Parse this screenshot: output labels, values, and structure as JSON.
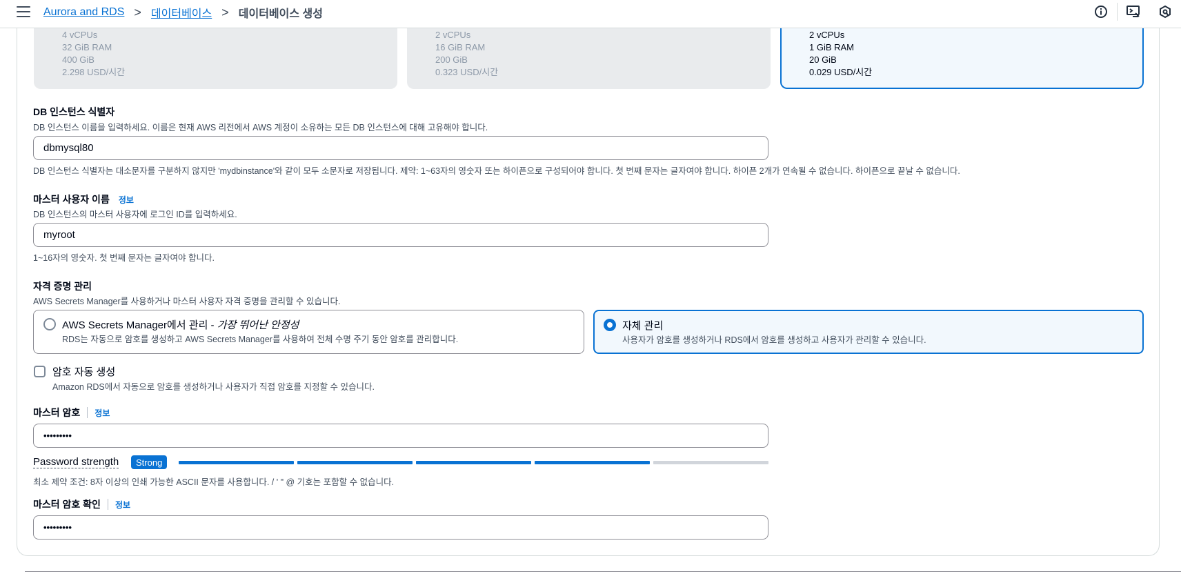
{
  "breadcrumb": {
    "items": [
      "Aurora and RDS",
      "데이터베이스"
    ],
    "current": "데이터베이스 생성",
    "separator": ">"
  },
  "top_icons": [
    "info-icon",
    "cloudshell-icon",
    "settings-hex-icon"
  ],
  "instance_cards": [
    {
      "state": "disabled",
      "lines": [
        "4 vCPUs",
        "32 GiB RAM",
        "400 GiB",
        "2.298 USD/시간"
      ]
    },
    {
      "state": "disabled",
      "lines": [
        "2 vCPUs",
        "16 GiB RAM",
        "200 GiB",
        "0.323 USD/시간"
      ]
    },
    {
      "state": "selected",
      "lines": [
        "2 vCPUs",
        "1 GiB RAM",
        "20 GiB",
        "0.029 USD/시간"
      ]
    }
  ],
  "db_identifier": {
    "label": "DB 인스턴스 식별자",
    "description": "DB 인스턴스 이름을 입력하세요. 이름은 현재 AWS 리전에서 AWS 계정이 소유하는 모든 DB 인스턴스에 대해 고유해야 합니다.",
    "value": "dbmysql80",
    "constraint": "DB 인스턴스 식별자는 대소문자를 구분하지 않지만 'mydbinstance'와 같이 모두 소문자로 저장됩니다. 제약: 1~63자의 영숫자 또는 하이픈으로 구성되어야 합니다. 첫 번째 문자는 글자여야 합니다. 하이픈 2개가 연속될 수 없습니다. 하이픈으로 끝날 수 없습니다."
  },
  "master_username": {
    "label": "마스터 사용자 이름",
    "info": "정보",
    "description": "DB 인스턴스의 마스터 사용자에 로그인 ID를 입력하세요.",
    "value": "myroot",
    "constraint": "1~16자의 영숫자. 첫 번째 문자는 글자여야 합니다."
  },
  "credentials": {
    "label": "자격 증명 관리",
    "description": "AWS Secrets Manager를 사용하거나 마스터 사용자 자격 증명을 관리할 수 있습니다.",
    "options": [
      {
        "title": "AWS Secrets Manager에서 관리 - ",
        "title_italic": "가장 뛰어난 안정성",
        "desc": "RDS는 자동으로 암호를 생성하고 AWS Secrets Manager를 사용하여 전체 수명 주기 동안 암호를 관리합니다.",
        "selected": false
      },
      {
        "title": "자체 관리",
        "desc": "사용자가 암호를 생성하거나 RDS에서 암호를 생성하고 사용자가 관리할 수 있습니다.",
        "selected": true
      }
    ]
  },
  "auto_password": {
    "label": "암호 자동 생성",
    "description": "Amazon RDS에서 자동으로 암호를 생성하거나 사용자가 직접 암호를 지정할 수 있습니다.",
    "checked": false
  },
  "master_password": {
    "label": "마스터 암호",
    "info": "정보",
    "value": "•••••••••",
    "strength_label": "Password strength",
    "strength_value": "Strong",
    "strength_level": 0.8,
    "constraint": "최소 제약 조건: 8자 이상의 인쇄 가능한 ASCII 문자를 사용합니다. / ' \" @ 기호는 포함할 수 없습니다."
  },
  "confirm_password": {
    "label": "마스터 암호 확인",
    "info": "정보",
    "value": "•••••••••"
  },
  "colors": {
    "accent": "#0972d3",
    "selected_bg": "#f2f8fd",
    "disabled_bg": "#e9ebed",
    "strength_empty": "#d1d5db"
  }
}
